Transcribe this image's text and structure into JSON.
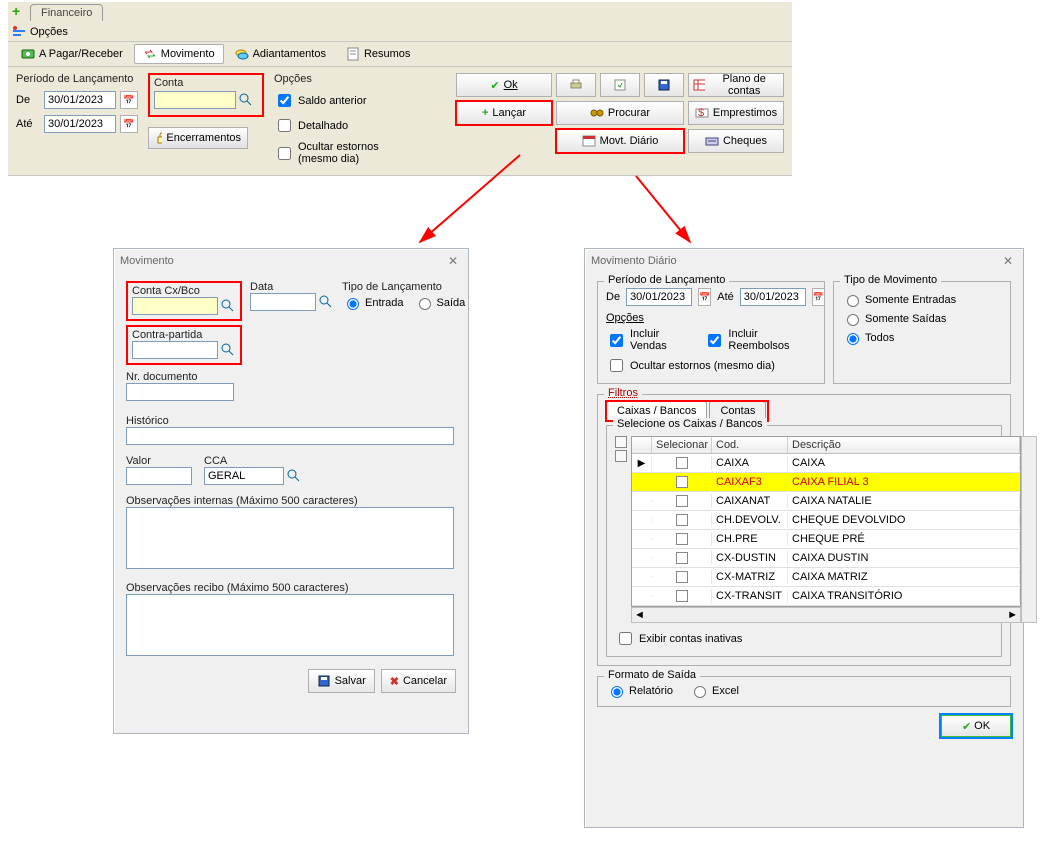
{
  "top": {
    "tab_financeiro": "Financeiro",
    "menu_opcoes": "Opções",
    "tabs": {
      "apagar": "A Pagar/Receber",
      "movimento": "Movimento",
      "adiantamentos": "Adiantamentos",
      "resumos": "Resumos"
    }
  },
  "toolbar": {
    "periodo_label": "Período de Lançamento",
    "de_label": "De",
    "ate_label": "Até",
    "de_value": "30/01/2023",
    "ate_value": "30/01/2023",
    "conta_label": "Conta",
    "encerramentos": "Encerramentos",
    "opcoes_label": "Opções",
    "saldo_anterior": "Saldo anterior",
    "detalhado": "Detalhado",
    "ocultar_estornos": "Ocultar estornos (mesmo dia)",
    "btn_ok": "Ok",
    "btn_lancar": "Lançar",
    "btn_procurar": "Procurar",
    "btn_movt_diario": "Movt. Diário",
    "btn_plano_contas": "Plano de contas",
    "btn_emprestimos": "Emprestimos",
    "btn_cheques": "Cheques"
  },
  "mov": {
    "title": "Movimento",
    "conta_label": "Conta Cx/Bco",
    "data_label": "Data",
    "tipo_label": "Tipo de Lançamento",
    "entrada": "Entrada",
    "saida": "Saída",
    "contra_label": "Contra-partida",
    "nrdoc_label": "Nr. documento",
    "historico_label": "Histórico",
    "valor_label": "Valor",
    "cca_label": "CCA",
    "cca_value": "GERAL",
    "obs_int_label": "Observações internas (Máximo 500 caracteres)",
    "obs_rec_label": "Observações recibo (Máximo 500 caracteres)",
    "salvar": "Salvar",
    "cancelar": "Cancelar"
  },
  "md": {
    "title": "Movimento Diário",
    "periodo_label": "Período de Lançamento",
    "de_label": "De",
    "ate_label": "Até",
    "de_value": "30/01/2023",
    "ate_value": "30/01/2023",
    "opcoes_label": "Opções",
    "incluir_vendas": "Incluir Vendas",
    "incluir_reembolsos": "Incluir Reembolsos",
    "ocultar_estornos": "Ocultar estornos (mesmo dia)",
    "tipo_label": "Tipo de Movimento",
    "tipo_entradas": "Somente Entradas",
    "tipo_saidas": "Somente Saídas",
    "tipo_todos": "Todos",
    "filtros_label": "Filtros",
    "tab_caixas": "Caixas / Bancos",
    "tab_contas": "Contas",
    "sel_label": "Selecione os Caixas / Bancos",
    "col_selecionar": "Selecionar",
    "col_cod": "Cod.",
    "col_desc": "Descrição",
    "rows": [
      {
        "cod": "CAIXA",
        "desc": "CAIXA",
        "ptr": true
      },
      {
        "cod": "CAIXAF3",
        "desc": "CAIXA FILIAL 3",
        "hl": true
      },
      {
        "cod": "CAIXANAT",
        "desc": "CAIXA NATALIE"
      },
      {
        "cod": "CH.DEVOLV.",
        "desc": "CHEQUE DEVOLVIDO"
      },
      {
        "cod": "CH.PRE",
        "desc": "CHEQUE PRÉ"
      },
      {
        "cod": "CX-DUSTIN",
        "desc": "CAIXA DUSTIN"
      },
      {
        "cod": "CX-MATRIZ",
        "desc": "CAIXA MATRIZ"
      },
      {
        "cod": "CX-TRANSIT",
        "desc": "CAIXA TRANSITÓRIO"
      }
    ],
    "exibir_inativas": "Exibir contas inativas",
    "formato_label": "Formato de Saída",
    "formato_rel": "Relatório",
    "formato_excel": "Excel",
    "ok_label": "OK"
  }
}
